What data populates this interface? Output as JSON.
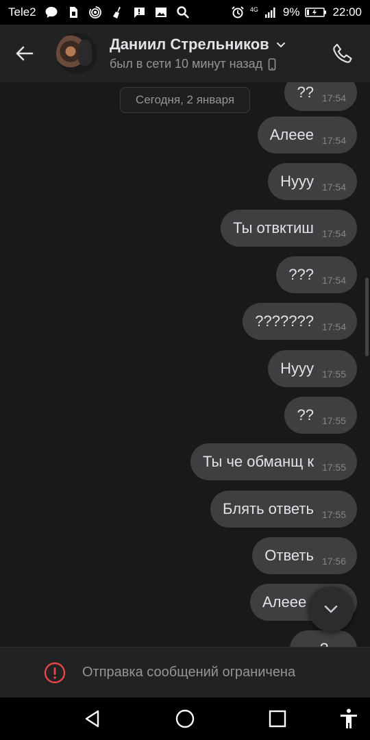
{
  "status_bar": {
    "carrier": "Tele2",
    "network": "4G",
    "battery": "9%",
    "time": "22:00",
    "left_icons": [
      "chat-bubble-icon",
      "sim-card-icon",
      "hotspot-icon",
      "clean-icon",
      "message-icon",
      "image-icon",
      "search-icon"
    ],
    "right_icons": [
      "alarm-icon",
      "signal-icon",
      "battery-icon"
    ]
  },
  "header": {
    "back_icon": "arrow-left-icon",
    "name": "Даниил Стрельников",
    "status": "был в сети 10 минут назад",
    "status_device_icon": "phone-device-icon",
    "call_icon": "phone-call-icon"
  },
  "chat": {
    "date_label": "Сегодня, 2 января",
    "messages": [
      {
        "text": "??",
        "time": "17:54"
      },
      {
        "text": "Алеее",
        "time": "17:54"
      },
      {
        "text": "Нууу",
        "time": "17:54"
      },
      {
        "text": "Ты отвктиш",
        "time": "17:54"
      },
      {
        "text": "???",
        "time": "17:54"
      },
      {
        "text": "???????",
        "time": "17:54"
      },
      {
        "text": "Нууу",
        "time": "17:55"
      },
      {
        "text": "??",
        "time": "17:55"
      },
      {
        "text": "Ты че обманщ к",
        "time": "17:55"
      },
      {
        "text": "Блять ответь",
        "time": "17:55"
      },
      {
        "text": "Ответь",
        "time": "17:56"
      },
      {
        "text": "Алеее",
        "time": ""
      },
      {
        "text": "?",
        "time": ""
      }
    ]
  },
  "composer": {
    "restricted_text": "Отправка сообщений ограничена",
    "icon": "warning-circle-icon",
    "accent_color": "#e64646"
  },
  "navbar": {
    "icons": [
      "back-triangle-icon",
      "home-circle-icon",
      "recents-square-icon",
      "accessibility-icon"
    ]
  }
}
